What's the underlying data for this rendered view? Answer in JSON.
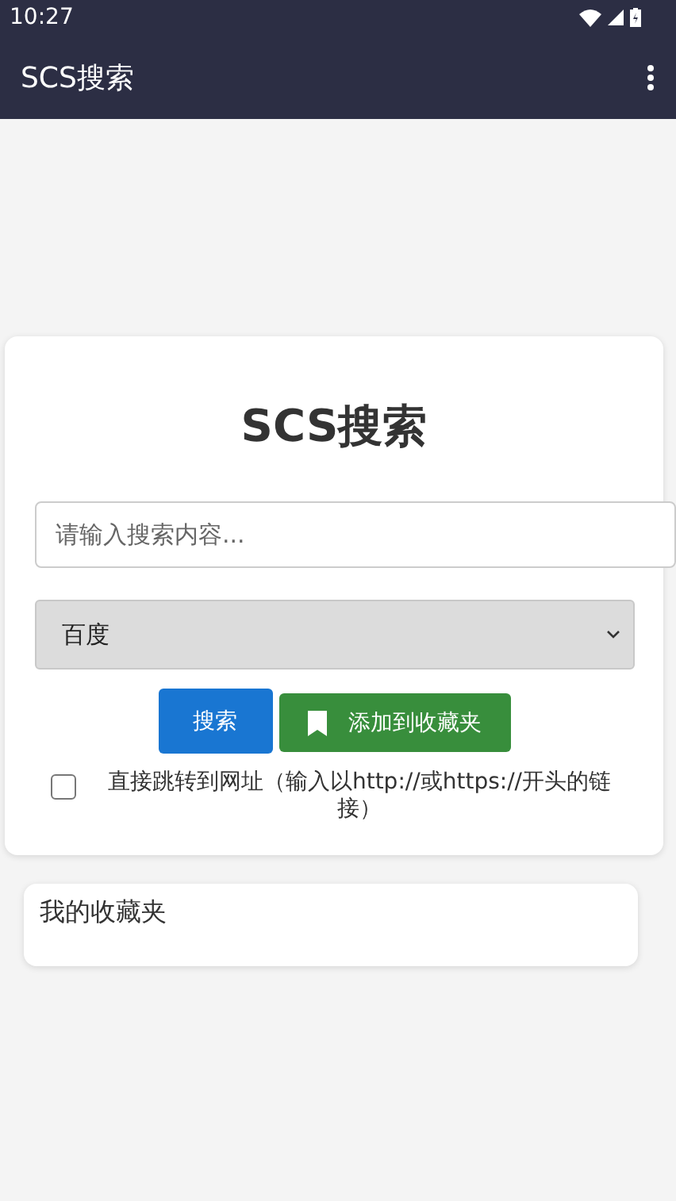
{
  "status_bar": {
    "time": "10:27"
  },
  "app_bar": {
    "title": "SCS搜索"
  },
  "search_card": {
    "heading": "SCS搜索",
    "search_field": {
      "placeholder": "请输入搜索内容..."
    },
    "engine_select": {
      "value": "百度"
    },
    "buttons": [
      {
        "kind": "primary",
        "label": "搜索"
      },
      {
        "kind": "bookmark",
        "label": "添加到收藏夹"
      }
    ],
    "direct_url": {
      "checked": false,
      "label": "直接跳转到网址（输入以http://或https://开头的链接）"
    }
  },
  "favorites": {
    "title": "我的收藏夹"
  }
}
